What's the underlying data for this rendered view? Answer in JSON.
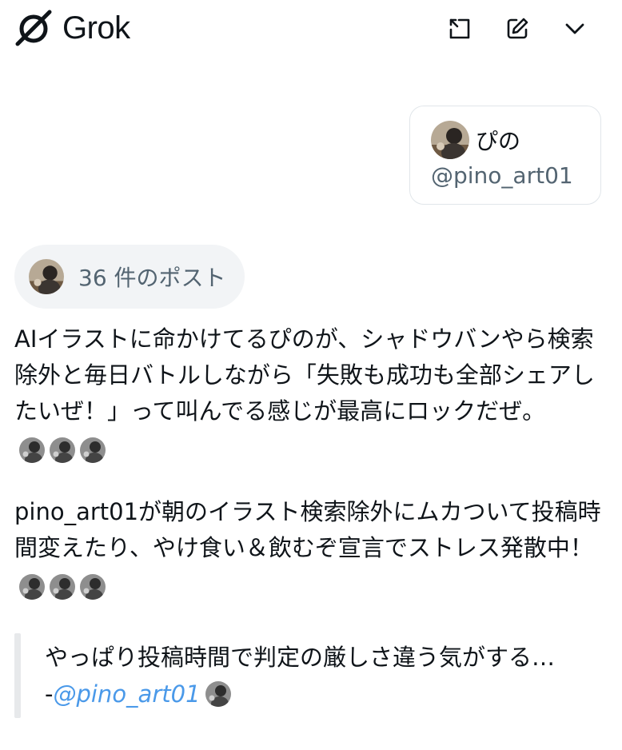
{
  "header": {
    "app_name": "Grok",
    "logo_icon": "grok-logo-icon",
    "actions": [
      {
        "name": "expand-icon"
      },
      {
        "name": "edit-icon"
      },
      {
        "name": "chevron-down-icon"
      }
    ]
  },
  "profile": {
    "display_name": "ぴの",
    "handle": "@pino_art01"
  },
  "posts_chip": {
    "label": "36 件のポスト"
  },
  "paragraphs": {
    "p1": "AIイラストに命かけてるぴのが、シャドウバンやら検索除外と毎日バトルしながら「失敗も成功も全部シェアしたいぜ！」って叫んでる感じが最高にロックだぜ。",
    "p2": "pino_art01が朝のイラスト検索除外にムカついて投稿時間変えたり、やけ食い＆飲むぞ宣言でストレス発散中！"
  },
  "quote": {
    "text": "やっぱり投稿時間で判定の厳しさ違う気がする…",
    "attribution_prefix": "-",
    "attribution_link": "@pino_art01"
  },
  "colors": {
    "text_primary": "#0f1419",
    "text_secondary": "#536471",
    "link": "#4a99e9",
    "chip_bg": "#f2f4f6",
    "card_border": "#e1e6ea"
  }
}
